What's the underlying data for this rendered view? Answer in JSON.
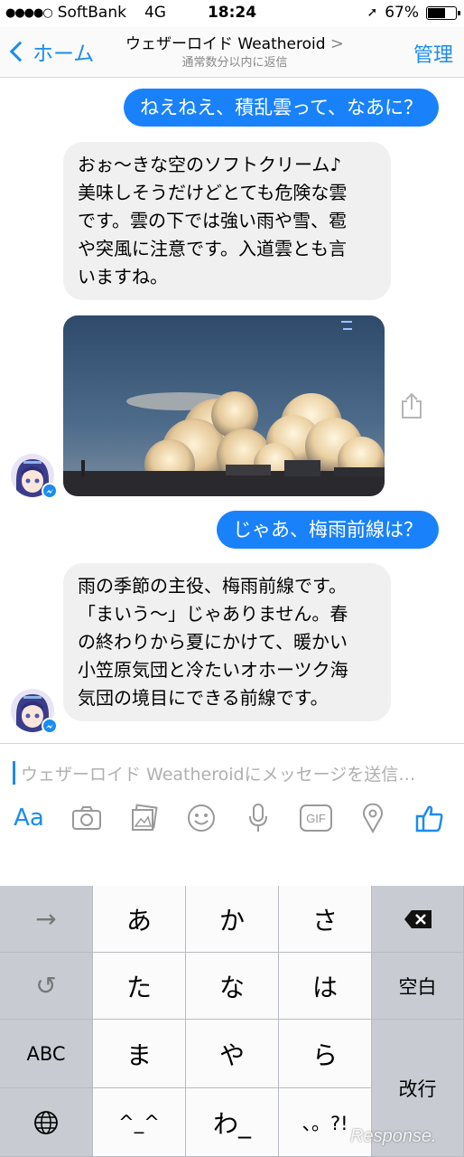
{
  "status_bar": {
    "carrier": "SoftBank",
    "network": "4G",
    "time": "18:24",
    "battery_percent": "67%",
    "battery_level": 0.67
  },
  "nav": {
    "back_label": "ホーム",
    "title": "ウェザーロイド Weatheroid",
    "title_arrow": ">",
    "subtitle": "通常数分以内に返信",
    "manage_label": "管理"
  },
  "messages": [
    {
      "from": "user",
      "text": "ねえねえ、積乱雲って、なあに？"
    },
    {
      "from": "bot",
      "lines": [
        "おぉ〜きな空のソフトクリーム♪",
        "美味しそうだけどとても危険な雲",
        "です。雲の下では強い雨や雪、雹",
        "や突風に注意です。入道雲とも言",
        "いますね。"
      ]
    },
    {
      "from": "bot",
      "type": "image",
      "icon": "cumulonimbus-photo"
    },
    {
      "from": "user",
      "text": "じゃあ、梅雨前線は？"
    },
    {
      "from": "bot",
      "lines": [
        "雨の季節の主役、梅雨前線です。",
        "「まいう〜」じゃありません。春",
        "の終わりから夏にかけて、暖かい",
        "小笠原気団と冷たいオホーツク海",
        "気団の境目にできる前線です。"
      ]
    }
  ],
  "composer": {
    "placeholder": "ウェザーロイド Weatheroidにメッセージを送信…",
    "aa_label": "Aa",
    "gif_label": "GIF",
    "tools": [
      "camera-icon",
      "gallery-icon",
      "emoji-icon",
      "microphone-icon",
      "gif-icon",
      "location-icon",
      "like-icon"
    ]
  },
  "keyboard": {
    "rows": [
      [
        "→",
        "あ",
        "か",
        "さ",
        "⌫"
      ],
      [
        "↺",
        "た",
        "な",
        "は",
        "空白"
      ],
      [
        "ABC",
        "ま",
        "や",
        "ら",
        "改行"
      ],
      [
        "🌐",
        "^_^",
        "わ_",
        "、。?!"
      ]
    ]
  },
  "watermark": "Response."
}
